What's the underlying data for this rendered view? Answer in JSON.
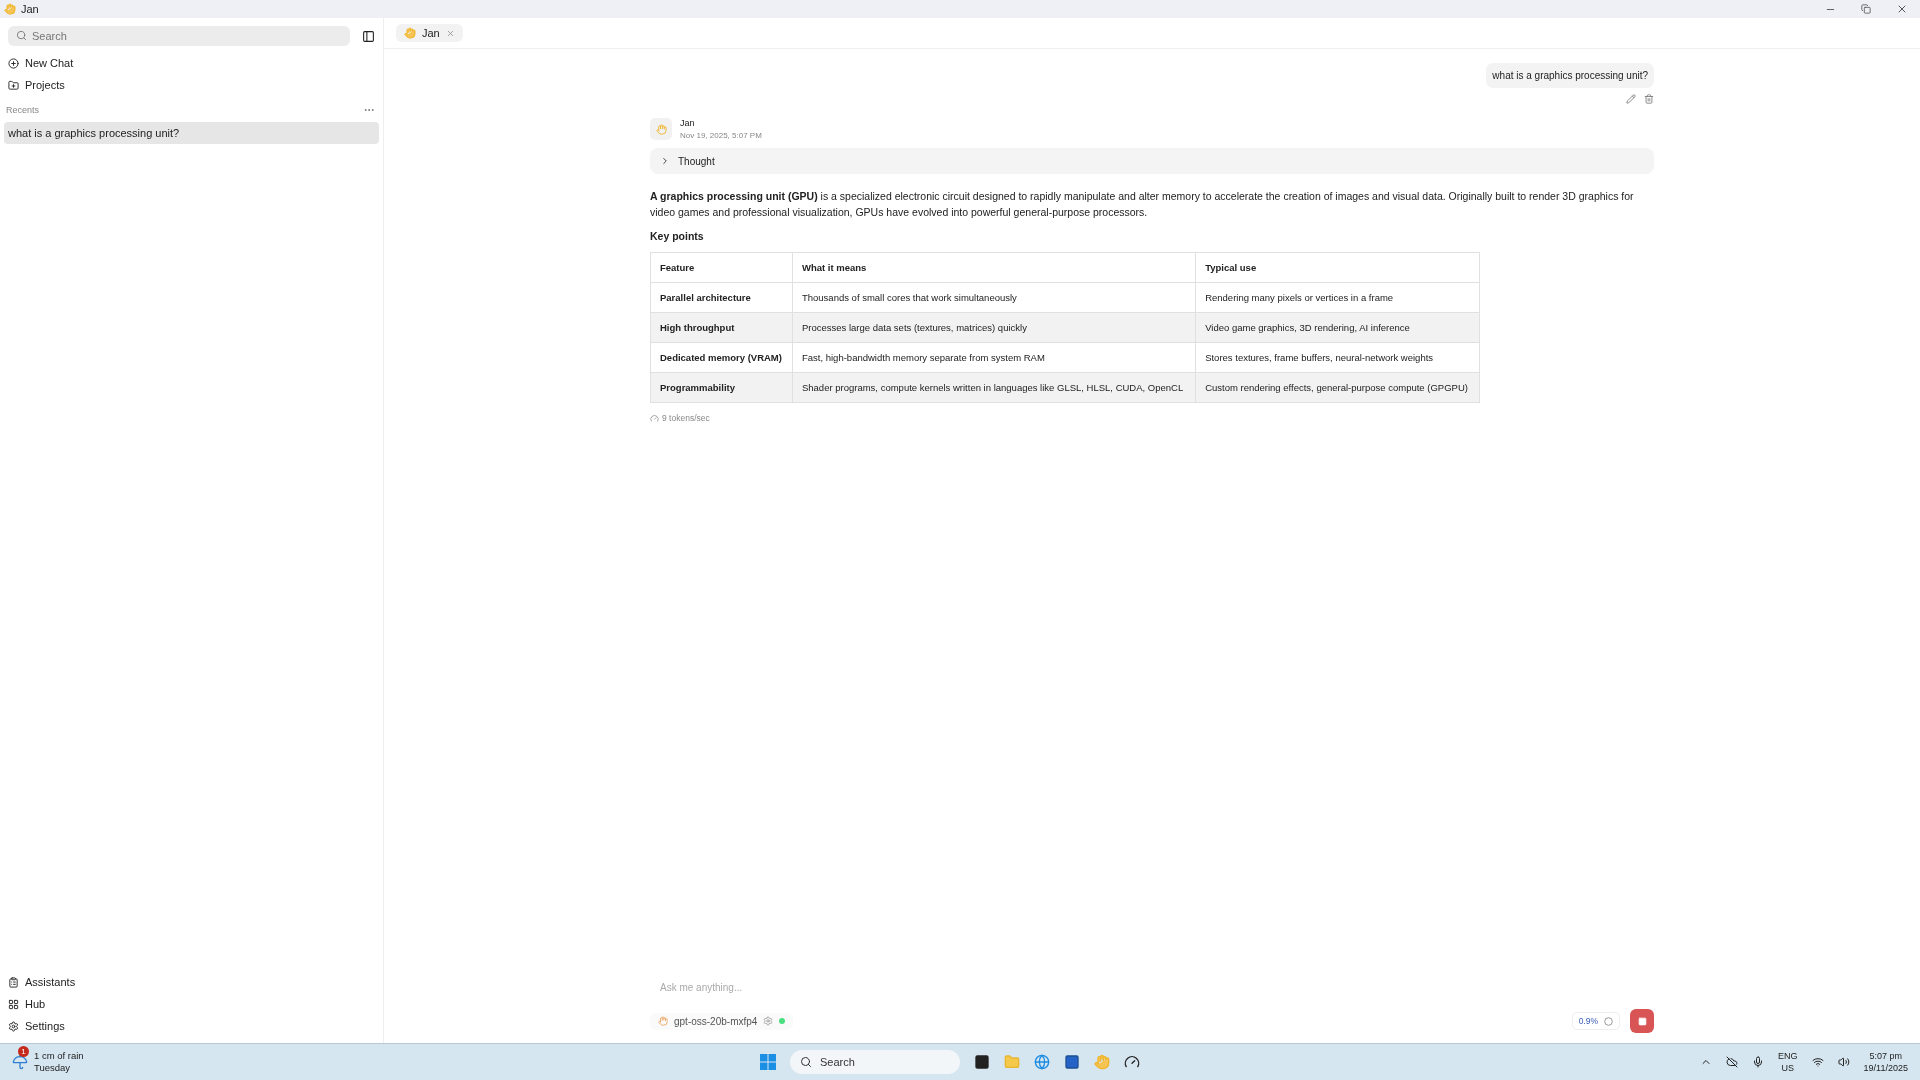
{
  "window": {
    "title": "Jan"
  },
  "sidebar": {
    "search": {
      "placeholder": "Search"
    },
    "nav": [
      {
        "kind": "new",
        "label": "New Chat"
      },
      {
        "kind": "projects",
        "label": "Projects"
      }
    ],
    "recents_label": "Recents",
    "recents": [
      {
        "label": "what is a graphics processing unit?",
        "selected": true
      }
    ],
    "bottom": [
      {
        "kind": "assistants",
        "label": "Assistants"
      },
      {
        "kind": "hub",
        "label": "Hub"
      },
      {
        "kind": "settings",
        "label": "Settings"
      }
    ]
  },
  "tab": {
    "label": "Jan"
  },
  "user_message": "what is a graphics processing unit?",
  "reply": {
    "author": "Jan",
    "time": "Nov 19, 2025, 5:07 PM",
    "thought_label": "Thought",
    "thought_expanded": false,
    "paragraph": "**A graphics processing unit (GPU)** is a specialized electronic circuit designed to rapidly manipulate and alter memory to accelerate the creation of images and visual data. Originally built to render 3D graphics for video games and professional visualization, GPUs have evolved into powerful general-purpose processors.",
    "heading": "Key points",
    "table": {
      "columns": [
        "Feature",
        "What it means",
        "Typical use"
      ],
      "rows": [
        [
          "Parallel architecture",
          "Thousands of small cores that work simultaneously",
          "Rendering many pixels or vertices in a frame"
        ],
        [
          "High throughput",
          "Processes large data sets (textures, matrices) quickly",
          "Video game graphics, 3D rendering, AI inference"
        ],
        [
          "Dedicated memory (VRAM)",
          "Fast, high-bandwidth memory separate from system RAM",
          "Stores textures, frame buffers, neural-network weights"
        ],
        [
          "Programmability",
          "Shader programs, compute kernels written in languages like GLSL, HLSL, CUDA, OpenCL",
          "Custom rendering effects, general-purpose compute (GPGPU)"
        ]
      ]
    },
    "speed": "9 tokens/sec"
  },
  "composer": {
    "placeholder": "Ask me anything...",
    "model": "gpt-oss-20b-mxfp4",
    "usage": "0.9%"
  },
  "taskbar": {
    "weather": {
      "badge": "1",
      "title": "1 cm of rain",
      "subtitle": "Tuesday"
    },
    "search": "Search",
    "lang": "ENG",
    "region": "US",
    "time": "5:07 pm",
    "date": "19/11/2025"
  }
}
